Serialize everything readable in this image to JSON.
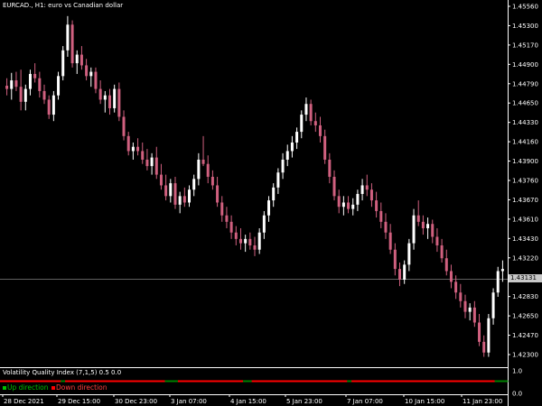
{
  "chart_title": "EURCAD., H1:  euro vs Canadian dollar",
  "indicator_title": "Volatility Quality Index (7,1,5) 0.5 0.0",
  "current_price": "1.43131",
  "price_axis": [
    "1.45560",
    "1.45300",
    "1.45170",
    "1.44900",
    "1.44790",
    "1.44650",
    "1.44330",
    "1.44160",
    "1.43900",
    "1.43760",
    "1.43670",
    "1.43610",
    "1.43430",
    "1.43220",
    "1.42980",
    "1.42830",
    "1.42650",
    "1.42470",
    "1.42300"
  ],
  "indicator_axis": [
    "1.0",
    "0.0"
  ],
  "time_axis": [
    "28 Dec 2021",
    "29 Dec 15:00",
    "30 Dec 23:00",
    "3 Jan 07:00",
    "4 Jan 15:00",
    "5 Jan 23:00",
    "7 Jan 07:00",
    "10 Jan 15:00",
    "11 Jan 23:00"
  ],
  "legend": [
    {
      "label": "Up direction",
      "color": "#00c000"
    },
    {
      "label": "Down direction",
      "color": "#ff0000"
    }
  ],
  "colors": {
    "bull": "#ffffff",
    "bear": "#d0607f",
    "grid": "#606060",
    "up": "#008000",
    "down": "#ff0000"
  },
  "chart_data": {
    "type": "candlestick",
    "ylim": [
      1.4222,
      1.4563
    ],
    "ohlc": [
      [
        1.4483,
        1.449,
        1.4474,
        1.448
      ],
      [
        1.448,
        1.4495,
        1.447,
        1.4488
      ],
      [
        1.4488,
        1.4496,
        1.4478,
        1.4482
      ],
      [
        1.4482,
        1.4498,
        1.446,
        1.4468
      ],
      [
        1.4468,
        1.4484,
        1.446,
        1.448
      ],
      [
        1.448,
        1.4498,
        1.4474,
        1.4494
      ],
      [
        1.4494,
        1.4504,
        1.4486,
        1.449
      ],
      [
        1.449,
        1.4496,
        1.4472,
        1.4478
      ],
      [
        1.4478,
        1.4484,
        1.4466,
        1.447
      ],
      [
        1.447,
        1.4474,
        1.4452,
        1.4456
      ],
      [
        1.4456,
        1.4478,
        1.445,
        1.4474
      ],
      [
        1.4474,
        1.4496,
        1.447,
        1.4492
      ],
      [
        1.4492,
        1.452,
        1.4488,
        1.4516
      ],
      [
        1.4516,
        1.4548,
        1.451,
        1.454
      ],
      [
        1.454,
        1.4544,
        1.45,
        1.4504
      ],
      [
        1.4504,
        1.4516,
        1.4494,
        1.4512
      ],
      [
        1.4512,
        1.452,
        1.4498,
        1.4502
      ],
      [
        1.4502,
        1.4508,
        1.4488,
        1.4492
      ],
      [
        1.4492,
        1.45,
        1.4482,
        1.4496
      ],
      [
        1.4496,
        1.45,
        1.4476,
        1.448
      ],
      [
        1.448,
        1.4488,
        1.4466,
        1.447
      ],
      [
        1.447,
        1.4478,
        1.4458,
        1.4474
      ],
      [
        1.4474,
        1.448,
        1.4456,
        1.4462
      ],
      [
        1.4462,
        1.4484,
        1.4458,
        1.448
      ],
      [
        1.448,
        1.4486,
        1.445,
        1.4454
      ],
      [
        1.4454,
        1.446,
        1.4432,
        1.4436
      ],
      [
        1.4436,
        1.444,
        1.4418,
        1.4422
      ],
      [
        1.4422,
        1.443,
        1.4414,
        1.4426
      ],
      [
        1.4426,
        1.4434,
        1.4418,
        1.4422
      ],
      [
        1.4422,
        1.443,
        1.441,
        1.4414
      ],
      [
        1.4414,
        1.4424,
        1.4404,
        1.4408
      ],
      [
        1.4408,
        1.442,
        1.44,
        1.4416
      ],
      [
        1.4416,
        1.4426,
        1.4396,
        1.44
      ],
      [
        1.44,
        1.441,
        1.4386,
        1.439
      ],
      [
        1.439,
        1.44,
        1.4376,
        1.438
      ],
      [
        1.438,
        1.4396,
        1.4374,
        1.4392
      ],
      [
        1.4392,
        1.4398,
        1.4368,
        1.4372
      ],
      [
        1.4372,
        1.4384,
        1.4364,
        1.438
      ],
      [
        1.438,
        1.4388,
        1.437,
        1.4374
      ],
      [
        1.4374,
        1.439,
        1.437,
        1.4386
      ],
      [
        1.4386,
        1.44,
        1.438,
        1.4396
      ],
      [
        1.4396,
        1.442,
        1.439,
        1.4414
      ],
      [
        1.4414,
        1.4436,
        1.4408,
        1.441
      ],
      [
        1.441,
        1.4418,
        1.4392,
        1.4398
      ],
      [
        1.4398,
        1.4404,
        1.4386,
        1.439
      ],
      [
        1.439,
        1.4398,
        1.437,
        1.4374
      ],
      [
        1.4374,
        1.438,
        1.4356,
        1.4362
      ],
      [
        1.4362,
        1.437,
        1.435,
        1.4356
      ],
      [
        1.4356,
        1.4362,
        1.434,
        1.4346
      ],
      [
        1.4346,
        1.4352,
        1.4334,
        1.434
      ],
      [
        1.434,
        1.435,
        1.433,
        1.4336
      ],
      [
        1.4336,
        1.4344,
        1.4328,
        1.434
      ],
      [
        1.434,
        1.4346,
        1.433,
        1.4334
      ],
      [
        1.4334,
        1.4342,
        1.4324,
        1.433
      ],
      [
        1.433,
        1.435,
        1.4326,
        1.4346
      ],
      [
        1.4346,
        1.4366,
        1.434,
        1.4362
      ],
      [
        1.4362,
        1.438,
        1.4356,
        1.4376
      ],
      [
        1.4376,
        1.4392,
        1.437,
        1.4388
      ],
      [
        1.4388,
        1.4406,
        1.4382,
        1.4402
      ],
      [
        1.4402,
        1.442,
        1.4396,
        1.4414
      ],
      [
        1.4414,
        1.4428,
        1.4408,
        1.4422
      ],
      [
        1.4422,
        1.4436,
        1.4416,
        1.443
      ],
      [
        1.443,
        1.4444,
        1.4424,
        1.444
      ],
      [
        1.444,
        1.446,
        1.4434,
        1.4456
      ],
      [
        1.4456,
        1.4472,
        1.445,
        1.4466
      ],
      [
        1.4466,
        1.447,
        1.4446,
        1.445
      ],
      [
        1.445,
        1.4458,
        1.444,
        1.4446
      ],
      [
        1.4446,
        1.4454,
        1.443,
        1.4436
      ],
      [
        1.4436,
        1.4442,
        1.441,
        1.4414
      ],
      [
        1.4414,
        1.442,
        1.4392,
        1.4398
      ],
      [
        1.4398,
        1.4404,
        1.4376,
        1.438
      ],
      [
        1.438,
        1.4386,
        1.4364,
        1.437
      ],
      [
        1.437,
        1.438,
        1.4362,
        1.4374
      ],
      [
        1.4374,
        1.438,
        1.4364,
        1.4368
      ],
      [
        1.4368,
        1.4378,
        1.4362,
        1.4372
      ],
      [
        1.4372,
        1.4386,
        1.4366,
        1.4382
      ],
      [
        1.4382,
        1.4396,
        1.4376,
        1.439
      ],
      [
        1.439,
        1.44,
        1.438,
        1.4386
      ],
      [
        1.4386,
        1.4392,
        1.437,
        1.4376
      ],
      [
        1.4376,
        1.4384,
        1.436,
        1.4366
      ],
      [
        1.4366,
        1.4374,
        1.435,
        1.4356
      ],
      [
        1.4356,
        1.4364,
        1.434,
        1.4346
      ],
      [
        1.4346,
        1.4354,
        1.4326,
        1.433
      ],
      [
        1.433,
        1.4336,
        1.4306,
        1.4312
      ],
      [
        1.4312,
        1.4318,
        1.4296,
        1.4302
      ],
      [
        1.4302,
        1.432,
        1.4298,
        1.4316
      ],
      [
        1.4316,
        1.434,
        1.431,
        1.4336
      ],
      [
        1.4336,
        1.4368,
        1.433,
        1.4362
      ],
      [
        1.4362,
        1.4376,
        1.4352,
        1.4356
      ],
      [
        1.4356,
        1.4362,
        1.4344,
        1.435
      ],
      [
        1.435,
        1.436,
        1.434,
        1.4354
      ],
      [
        1.4354,
        1.4358,
        1.4336,
        1.4342
      ],
      [
        1.4342,
        1.435,
        1.4328,
        1.4334
      ],
      [
        1.4334,
        1.434,
        1.4318,
        1.4322
      ],
      [
        1.4322,
        1.433,
        1.4306,
        1.431
      ],
      [
        1.431,
        1.4316,
        1.4294,
        1.43
      ],
      [
        1.43,
        1.4306,
        1.4284,
        1.429
      ],
      [
        1.429,
        1.4298,
        1.4276,
        1.4282
      ],
      [
        1.4282,
        1.4288,
        1.4266,
        1.4272
      ],
      [
        1.4272,
        1.428,
        1.4264,
        1.4276
      ],
      [
        1.4276,
        1.4282,
        1.4258,
        1.4262
      ],
      [
        1.4262,
        1.427,
        1.424,
        1.4244
      ],
      [
        1.4244,
        1.425,
        1.423,
        1.4234
      ],
      [
        1.4234,
        1.427,
        1.423,
        1.4266
      ],
      [
        1.4266,
        1.4294,
        1.426,
        1.429
      ],
      [
        1.429,
        1.4314,
        1.4286,
        1.431
      ],
      [
        1.431,
        1.432,
        1.43,
        1.4312
      ]
    ],
    "indicator_colors": "rrrrrrrrrrrrrrgrrrrrrrrrrrrrrrrrrrrrrrgggrrrrrrrrrrrrrrrggrrrrrrrrrrrrrrrrrrrrrrgrrrrrrrrrrrrrrrrrrrrrrrrrrrrrrrrrggg"
  }
}
